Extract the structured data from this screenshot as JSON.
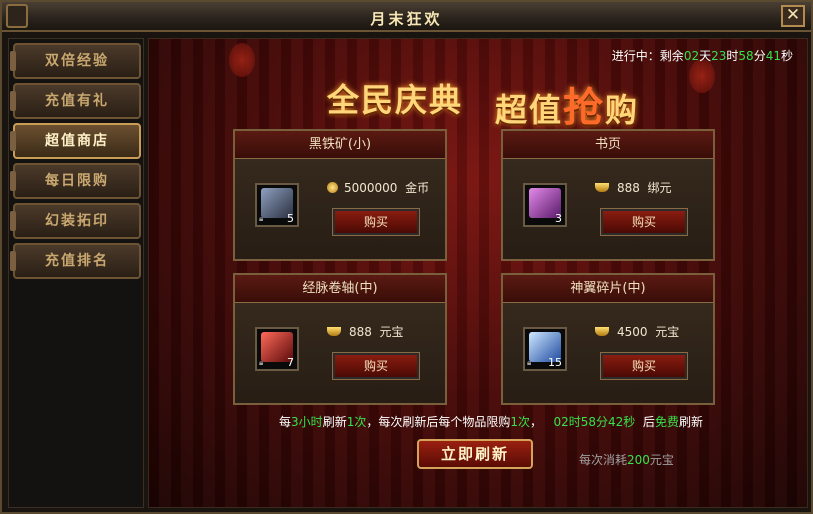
{
  "window": {
    "title": "月末狂欢"
  },
  "sidebar": {
    "items": [
      {
        "label": "双倍经验",
        "active": false
      },
      {
        "label": "充值有礼",
        "active": false
      },
      {
        "label": "超值商店",
        "active": true
      },
      {
        "label": "每日限购",
        "active": false
      },
      {
        "label": "幻装拓印",
        "active": false
      },
      {
        "label": "充值排名",
        "active": false
      }
    ]
  },
  "timer": {
    "prefix": "进行中：剩余",
    "days": "02",
    "days_unit": "天",
    "hours": "23",
    "hours_unit": "时",
    "minutes": "58",
    "minutes_unit": "分",
    "seconds": "41",
    "seconds_unit": "秒"
  },
  "banner": {
    "left": "全民庆典",
    "right_a": "超值",
    "right_big": "抢",
    "right_b": "购"
  },
  "items": [
    {
      "name": "黑铁矿(小)",
      "quantity": "5",
      "price": "5000000",
      "currency": "金币",
      "currency_icon": "gold-coin-icon",
      "buy_label": "购买",
      "art_color": "#5a6a8a"
    },
    {
      "name": "书页",
      "quantity": "3",
      "price": "888",
      "currency": "绑元",
      "currency_icon": "bound-ingot-icon",
      "buy_label": "购买",
      "art_color": "#b04ab8"
    },
    {
      "name": "经脉卷轴(中)",
      "quantity": "7",
      "price": "888",
      "currency": "元宝",
      "currency_icon": "ingot-icon",
      "buy_label": "购买",
      "art_color": "#c02a2a"
    },
    {
      "name": "神翼碎片(中)",
      "quantity": "15",
      "price": "4500",
      "currency": "元宝",
      "currency_icon": "ingot-icon",
      "buy_label": "购买",
      "art_color": "#4a8ae0"
    }
  ],
  "refresh": {
    "t1": "每",
    "hours": "3小时",
    "t2": "刷新",
    "times": "1次",
    "t3": "，每次刷新后每个物品限购",
    "limit": "1次",
    "t4": "，",
    "countdown": "02时58分42秒",
    "t5": "后",
    "free": "免费",
    "t6": "刷新",
    "button_label": "立即刷新",
    "cost_prefix": "每次消耗",
    "cost_value": "200",
    "cost_suffix": "元宝"
  },
  "colors": {
    "accent_green": "#37e24a",
    "gold_text": "#ffd77a",
    "panel_border": "#7a5f3c"
  }
}
